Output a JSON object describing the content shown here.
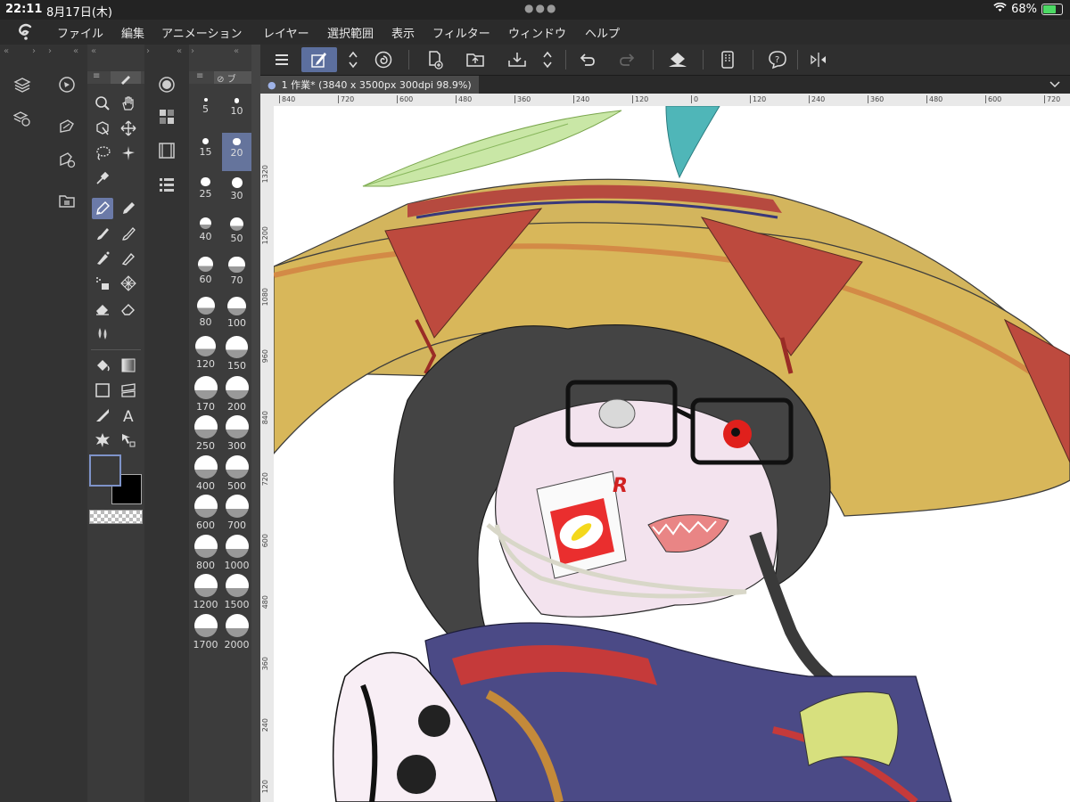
{
  "status": {
    "time": "22:11",
    "date": "8月17日(木)",
    "battery": "68%",
    "battery_level": 0.68
  },
  "menu": [
    "ファイル",
    "編集",
    "アニメーション",
    "レイヤー",
    "選択範囲",
    "表示",
    "フィルター",
    "ウィンドウ",
    "ヘルプ"
  ],
  "document": {
    "tab_title": "1 作業* (3840 x 3500px 300dpi 98.9%)"
  },
  "brush_sizes": [
    "5",
    "10",
    "15",
    "20",
    "25",
    "30",
    "40",
    "50",
    "60",
    "70",
    "80",
    "100",
    "120",
    "150",
    "170",
    "200",
    "250",
    "300",
    "400",
    "500",
    "600",
    "700",
    "800",
    "1000",
    "1200",
    "1500",
    "1700",
    "2000"
  ],
  "selected_brush_size": "20",
  "ruler": {
    "horizontal": [
      "840",
      "720",
      "600",
      "480",
      "360",
      "240",
      "120",
      "0",
      "120",
      "240",
      "360",
      "480",
      "600",
      "720"
    ],
    "vertical": [
      "1320",
      "1200",
      "1080",
      "960",
      "840",
      "720",
      "600",
      "480",
      "360",
      "240",
      "120"
    ]
  },
  "colors": {
    "main_color": "#3a3a3a",
    "sub_color": "#000000",
    "accent_selected": "#6b7aa8"
  },
  "icons": {
    "toolbar": [
      "menu-icon",
      "pen-edit-icon",
      "updown-icon",
      "spiral-icon",
      "new-doc-icon",
      "open-folder-icon",
      "save-icon",
      "updown-icon",
      "undo-icon",
      "redo-icon",
      "fill-icon",
      "device-icon",
      "help-icon",
      "flip-icon"
    ]
  }
}
